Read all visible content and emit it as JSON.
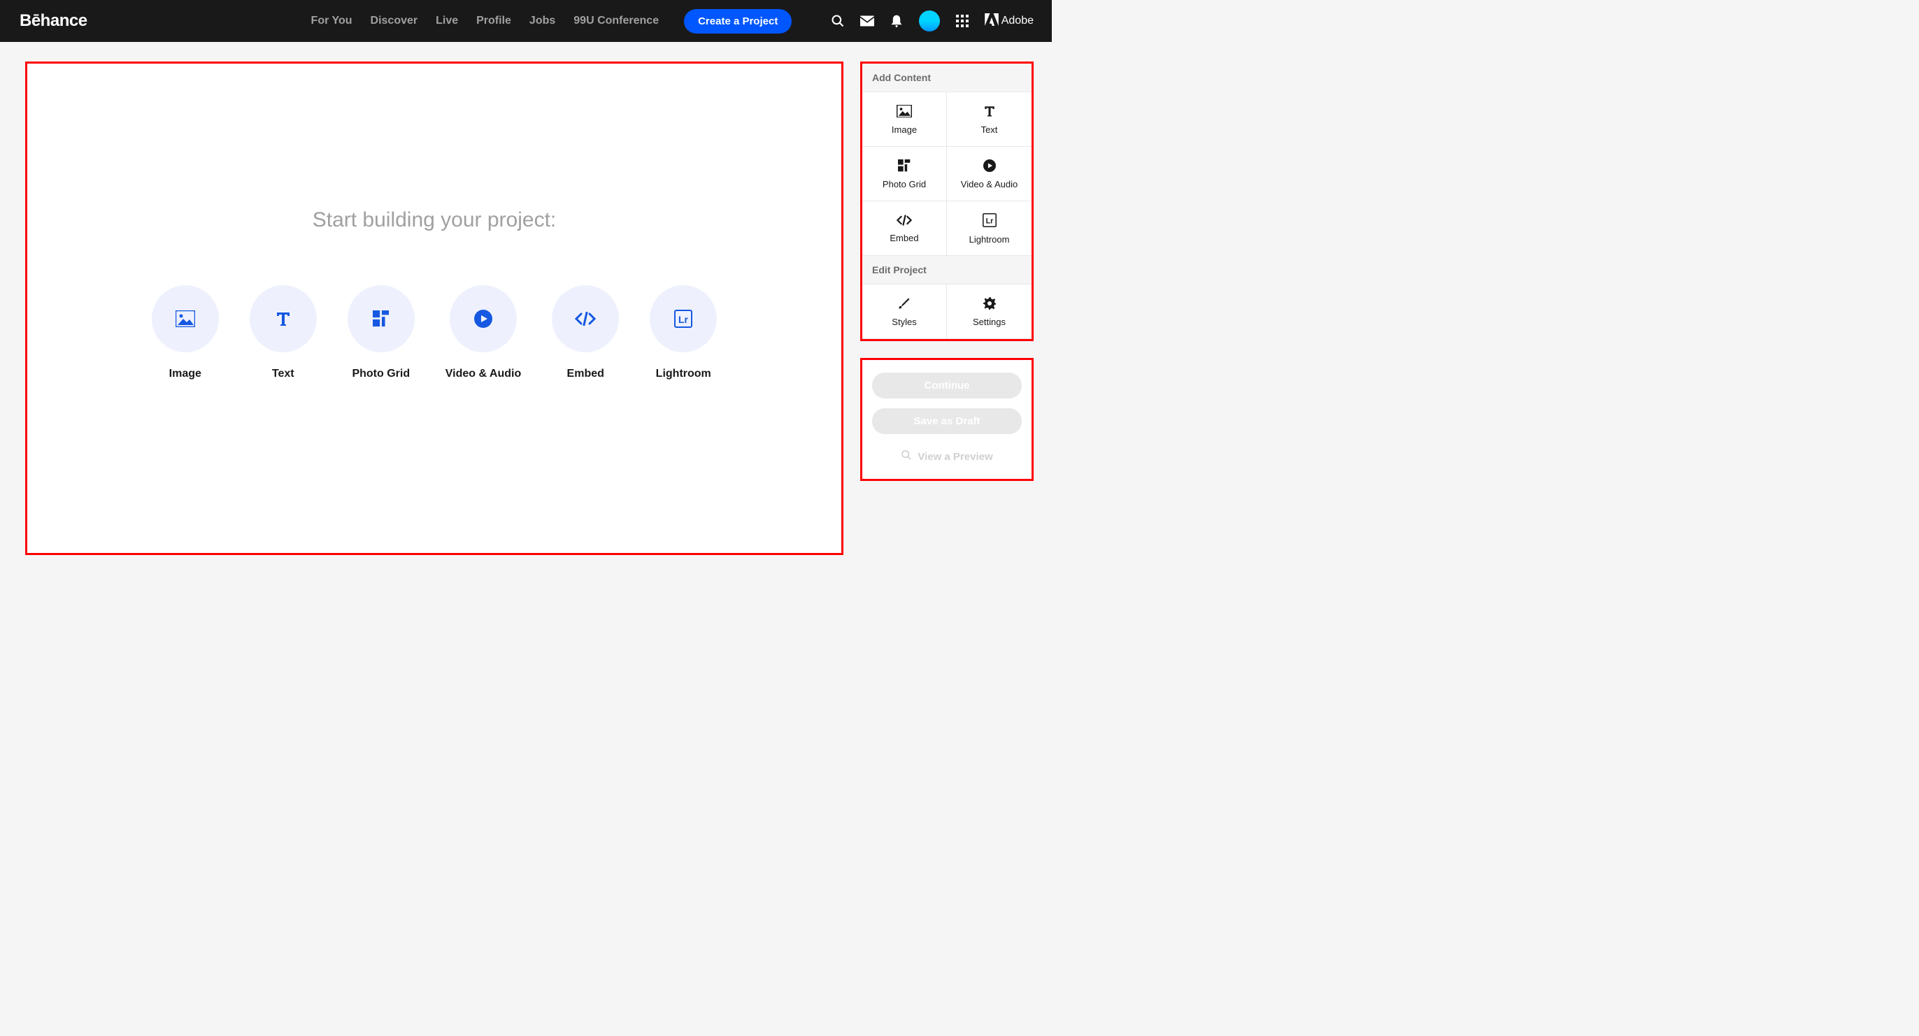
{
  "header": {
    "logo": "Bēhance",
    "nav": [
      "For You",
      "Discover",
      "Live",
      "Profile",
      "Jobs",
      "99U Conference"
    ],
    "create_btn": "Create a Project",
    "adobe": "Adobe"
  },
  "canvas": {
    "title": "Start building your project:",
    "options": [
      {
        "label": "Image",
        "icon": "image"
      },
      {
        "label": "Text",
        "icon": "text"
      },
      {
        "label": "Photo Grid",
        "icon": "grid"
      },
      {
        "label": "Video & Audio",
        "icon": "play"
      },
      {
        "label": "Embed",
        "icon": "code"
      },
      {
        "label": "Lightroom",
        "icon": "lr"
      }
    ]
  },
  "sidebar": {
    "add_header": "Add Content",
    "add_items": [
      {
        "label": "Image",
        "icon": "image"
      },
      {
        "label": "Text",
        "icon": "text"
      },
      {
        "label": "Photo Grid",
        "icon": "grid"
      },
      {
        "label": "Video & Audio",
        "icon": "play"
      },
      {
        "label": "Embed",
        "icon": "code"
      },
      {
        "label": "Lightroom",
        "icon": "lr"
      }
    ],
    "edit_header": "Edit Project",
    "edit_items": [
      {
        "label": "Styles",
        "icon": "brush"
      },
      {
        "label": "Settings",
        "icon": "gear"
      }
    ]
  },
  "actions": {
    "continue": "Continue",
    "save_draft": "Save as Draft",
    "preview": "View a Preview"
  },
  "colors": {
    "accent": "#0057ff",
    "highlight_border": "#ff0000"
  }
}
